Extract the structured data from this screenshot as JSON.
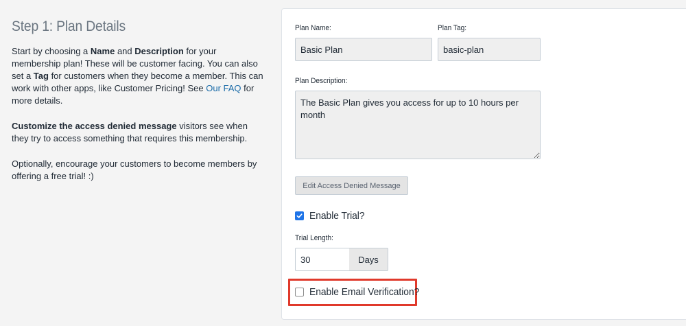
{
  "step": {
    "title": "Step 1: Plan Details",
    "p1": {
      "t1": "Start by choosing a ",
      "b1": "Name",
      "t2": " and ",
      "b2": "Description",
      "t3": " for your membership plan! These will be customer facing. You can also set a ",
      "b3": "Tag",
      "t4": " for customers when they become a member. This can work with other apps, like Customer Pricing! See ",
      "link": "Our FAQ",
      "t5": " for more details."
    },
    "p2": {
      "b1": "Customize the access denied message",
      "t1": " visitors see when they try to access something that requires this membership."
    },
    "p3": "Optionally, encourage your customers to become members by offering a free trial! :)"
  },
  "form": {
    "plan_name_label": "Plan Name:",
    "plan_name_value": "Basic Plan",
    "plan_tag_label": "Plan Tag:",
    "plan_tag_value": "basic-plan",
    "plan_description_label": "Plan Description:",
    "plan_description_value": "The Basic Plan gives you access for up to 10 hours per month",
    "edit_button_label": "Edit Access Denied Message",
    "enable_trial_label": "Enable Trial?",
    "enable_trial_checked": true,
    "trial_length_label": "Trial Length:",
    "trial_length_value": "30",
    "trial_unit": "Days",
    "enable_email_label": "Enable Email Verification?",
    "enable_email_checked": false
  },
  "colors": {
    "accent": "#1e74e8",
    "link": "#1a6ba8",
    "highlight": "#e0392b"
  }
}
